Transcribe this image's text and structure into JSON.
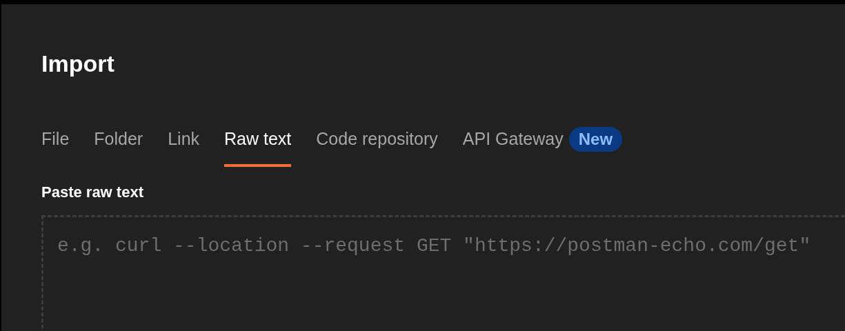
{
  "title": "Import",
  "tabs": [
    {
      "label": "File",
      "selected": false
    },
    {
      "label": "Folder",
      "selected": false
    },
    {
      "label": "Link",
      "selected": false
    },
    {
      "label": "Raw text",
      "selected": true
    },
    {
      "label": "Code repository",
      "selected": false
    },
    {
      "label": "API Gateway",
      "selected": false,
      "badge": "New"
    }
  ],
  "raw_text": {
    "label": "Paste raw text",
    "placeholder": "e.g. curl --location --request GET \"https://postman-echo.com/get\""
  }
}
